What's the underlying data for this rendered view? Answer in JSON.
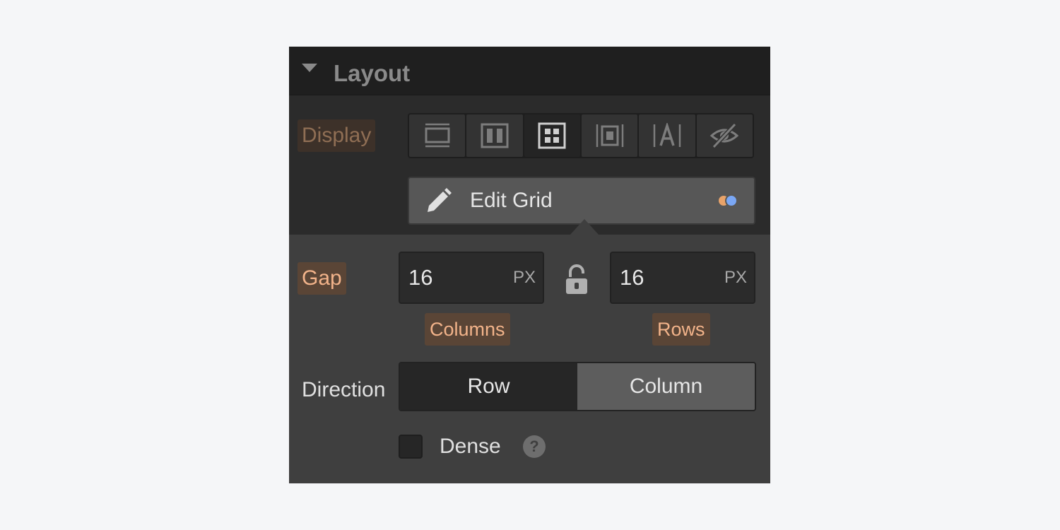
{
  "header": {
    "title": "Layout"
  },
  "display": {
    "label": "Display",
    "options": [
      {
        "icon": "block-icon",
        "active": false
      },
      {
        "icon": "flex-icon",
        "active": false
      },
      {
        "icon": "grid-icon",
        "active": true
      },
      {
        "icon": "inline-block-icon",
        "active": false
      },
      {
        "icon": "inline-text-icon",
        "active": false
      },
      {
        "icon": "hidden-icon",
        "active": false
      }
    ]
  },
  "edit_grid": {
    "label": "Edit Grid",
    "icon": "pencil-icon"
  },
  "gap": {
    "label": "Gap",
    "columns": {
      "value": "16",
      "unit": "PX",
      "label": "Columns"
    },
    "rows": {
      "value": "16",
      "unit": "PX",
      "label": "Rows"
    },
    "lock_icon": "unlock-icon"
  },
  "direction": {
    "label": "Direction",
    "options": [
      "Row",
      "Column"
    ],
    "selected": "Row"
  },
  "dense": {
    "label": "Dense",
    "checked": false,
    "help": "?"
  },
  "colors": {
    "accent_label_bg": "#5a4536",
    "accent_label_text": "#f2b38a",
    "indicator_orange": "#e8a36a",
    "indicator_blue": "#7aa7f5"
  }
}
